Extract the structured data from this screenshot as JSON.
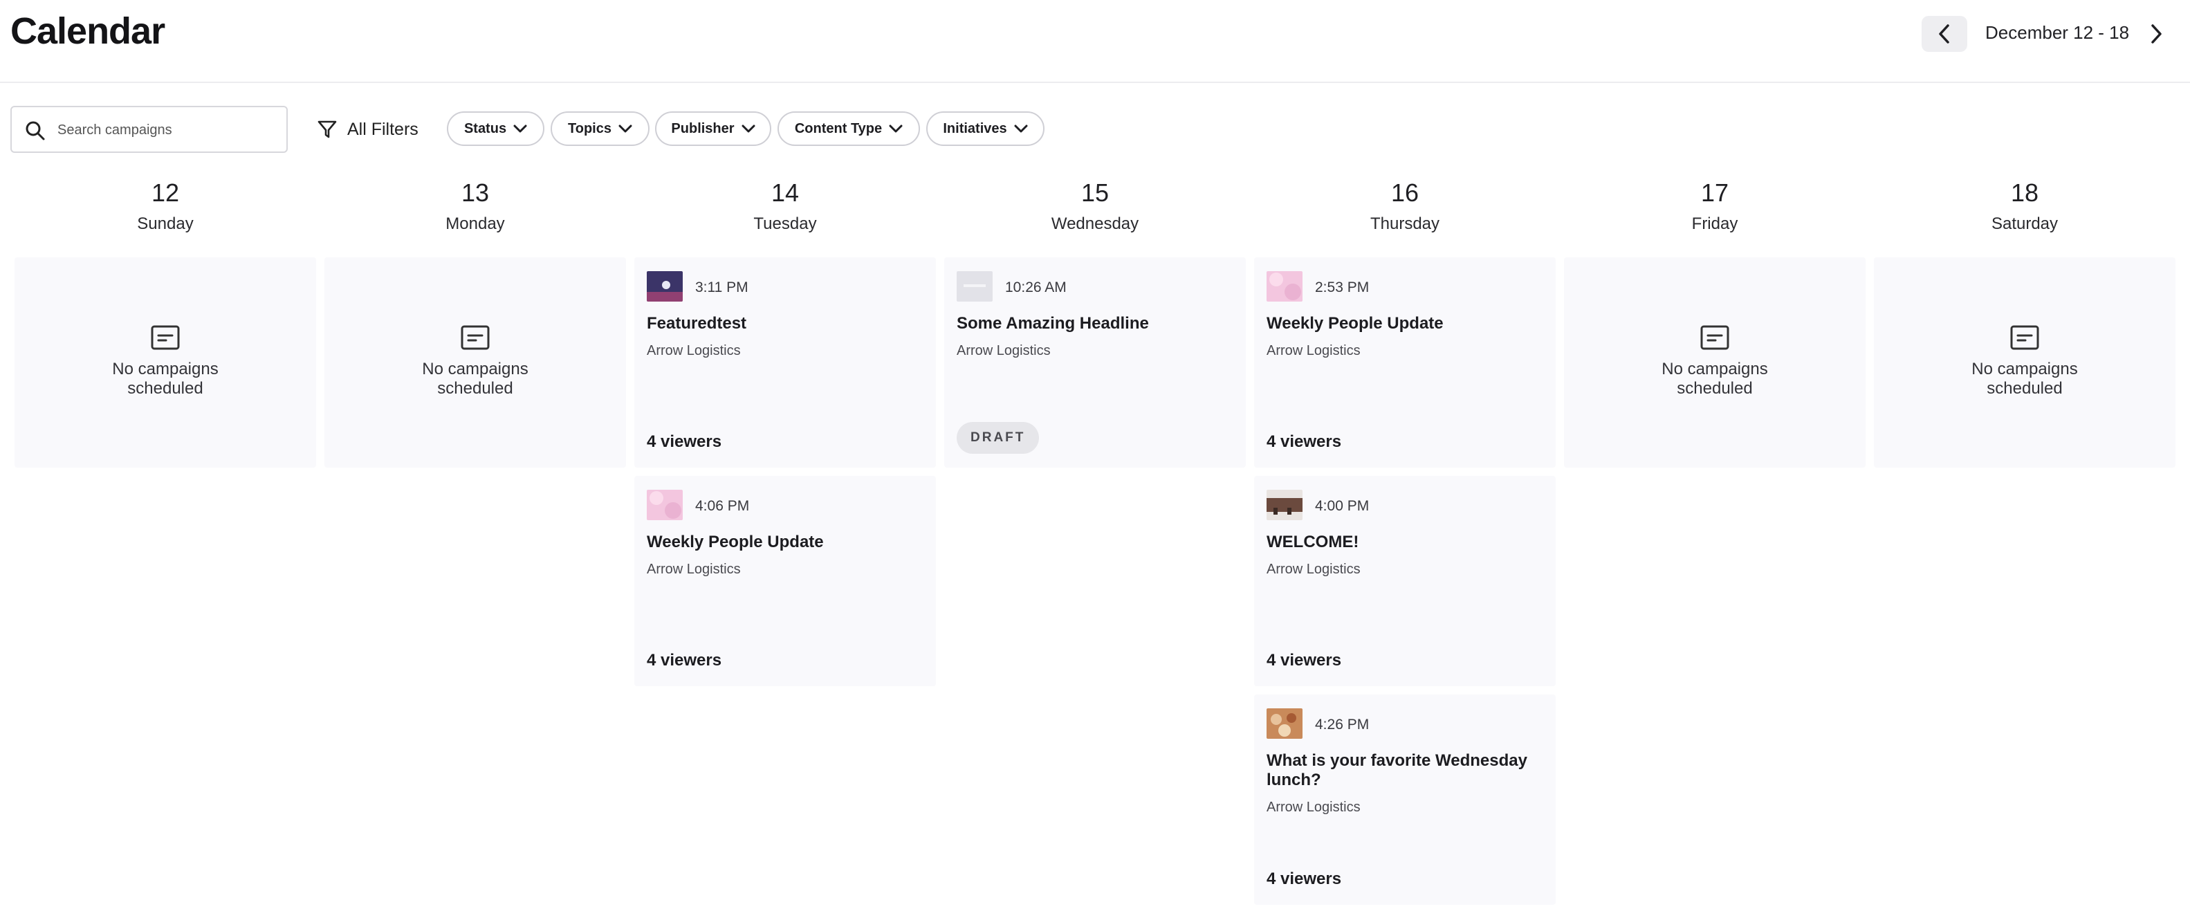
{
  "header": {
    "title": "Calendar",
    "date_range": "December 12 - 18"
  },
  "search": {
    "placeholder": "Search campaigns"
  },
  "filters": {
    "all_filters_label": "All Filters",
    "chips": [
      "Status",
      "Topics",
      "Publisher",
      "Content Type",
      "Initiatives"
    ]
  },
  "days": [
    {
      "num": "12",
      "name": "Sunday"
    },
    {
      "num": "13",
      "name": "Monday"
    },
    {
      "num": "14",
      "name": "Tuesday"
    },
    {
      "num": "15",
      "name": "Wednesday"
    },
    {
      "num": "16",
      "name": "Thursday"
    },
    {
      "num": "17",
      "name": "Friday"
    },
    {
      "num": "18",
      "name": "Saturday"
    }
  ],
  "empty_text": "No campaigns scheduled",
  "campaigns": {
    "tue_1": {
      "time": "3:11 PM",
      "title": "Featuredtest",
      "publisher": "Arrow Logistics",
      "viewers": "4 viewers",
      "thumb_color": "#3b3468"
    },
    "tue_2": {
      "time": "4:06 PM",
      "title": "Weekly People Update",
      "publisher": "Arrow Logistics",
      "viewers": "4 viewers",
      "thumb_color": "#f3c6df"
    },
    "wed_1": {
      "time": "10:26 AM",
      "title": "Some Amazing Headline",
      "publisher": "Arrow Logistics",
      "badge": "DRAFT",
      "thumb_color": "#e2e2e8"
    },
    "thu_1": {
      "time": "2:53 PM",
      "title": "Weekly People Update",
      "publisher": "Arrow Logistics",
      "viewers": "4 viewers",
      "thumb_color": "#f3c6df"
    },
    "thu_2": {
      "time": "4:00 PM",
      "title": "WELCOME!",
      "publisher": "Arrow Logistics",
      "viewers": "4 viewers",
      "thumb_color": "#6b4a3e"
    },
    "thu_3": {
      "time": "4:26 PM",
      "title": "What is your favorite Wednesday lunch?",
      "publisher": "Arrow Logistics",
      "viewers": "4 viewers",
      "thumb_color": "#c98a5a"
    }
  },
  "colors": {
    "card_bg": "#f9f9fc",
    "badge_bg": "#e6e6ea"
  }
}
